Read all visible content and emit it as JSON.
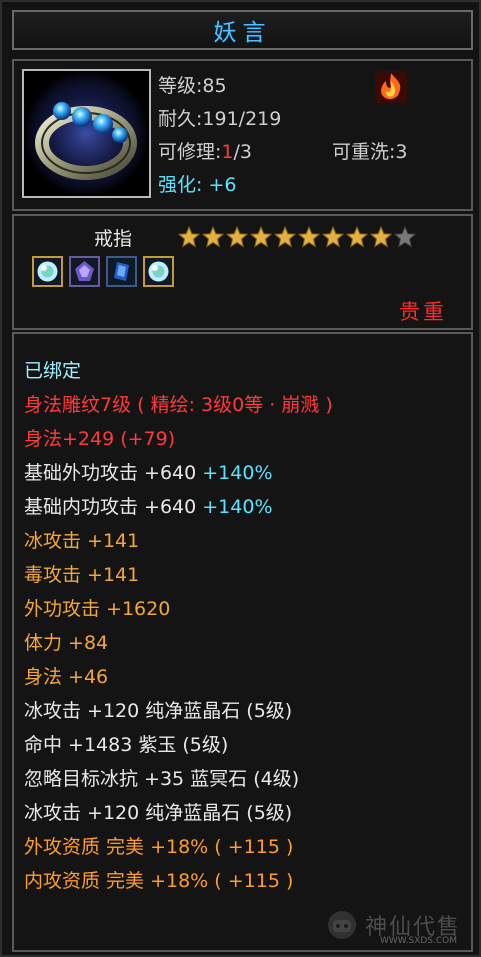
{
  "item": {
    "name": "妖言",
    "level_label": "等级",
    "level_value": ":85",
    "durability_label": "耐久",
    "durability_value": ":191/219",
    "repair_label": "可修理:",
    "repair_current": "1",
    "repair_total": "/3",
    "rewash_label": "可重洗:",
    "rewash_value": "3",
    "enhance_label": "强化: ",
    "enhance_value": "+6",
    "type": "戒指",
    "stars_filled": 9,
    "stars_total": 10,
    "quality": "贵重",
    "gems": [
      "gem-light-icon",
      "gem-purple-icon",
      "gem-blue-icon",
      "gem-light-icon"
    ]
  },
  "attributes": [
    {
      "segments": [
        {
          "text": "已绑定",
          "color": "lightcyan"
        }
      ]
    },
    {
      "segments": [
        {
          "text": "身法雕纹7级 ( 精绘: 3级0等 · 崩溅 )",
          "color": "red"
        }
      ]
    },
    {
      "segments": [
        {
          "text": "身法+249 (+79)",
          "color": "red"
        }
      ]
    },
    {
      "segments": [
        {
          "text": "基础外功攻击 +640 ",
          "color": "white"
        },
        {
          "text": "+140%",
          "color": "cyan"
        }
      ]
    },
    {
      "segments": [
        {
          "text": "基础内功攻击 +640 ",
          "color": "white"
        },
        {
          "text": "+140%",
          "color": "cyan"
        }
      ]
    },
    {
      "segments": [
        {
          "text": "冰攻击 +141",
          "color": "gold"
        }
      ]
    },
    {
      "segments": [
        {
          "text": "毒攻击 +141",
          "color": "gold"
        }
      ]
    },
    {
      "segments": [
        {
          "text": "外功攻击 +1620",
          "color": "gold"
        }
      ]
    },
    {
      "segments": [
        {
          "text": "体力 +84",
          "color": "gold"
        }
      ]
    },
    {
      "segments": [
        {
          "text": "身法 +46",
          "color": "gold"
        }
      ]
    },
    {
      "segments": [
        {
          "text": "冰攻击 +120 纯净蓝晶石 (5级)",
          "color": "white"
        }
      ]
    },
    {
      "segments": [
        {
          "text": "命中 +1483 紫玉 (5级)",
          "color": "white"
        }
      ]
    },
    {
      "segments": [
        {
          "text": "忽略目标冰抗 +35 蓝冥石 (4级)",
          "color": "white"
        }
      ]
    },
    {
      "segments": [
        {
          "text": "冰攻击 +120 纯净蓝晶石 (5级)",
          "color": "white"
        }
      ]
    },
    {
      "segments": [
        {
          "text": "外攻资质   完美 +18% ( +115 )",
          "color": "orange"
        }
      ]
    },
    {
      "segments": [
        {
          "text": "内攻资质   完美 +18% ( +115 )",
          "color": "orange"
        }
      ]
    }
  ],
  "watermark": {
    "text": "神仙代售",
    "url": "WWW.SXDS.COM"
  }
}
